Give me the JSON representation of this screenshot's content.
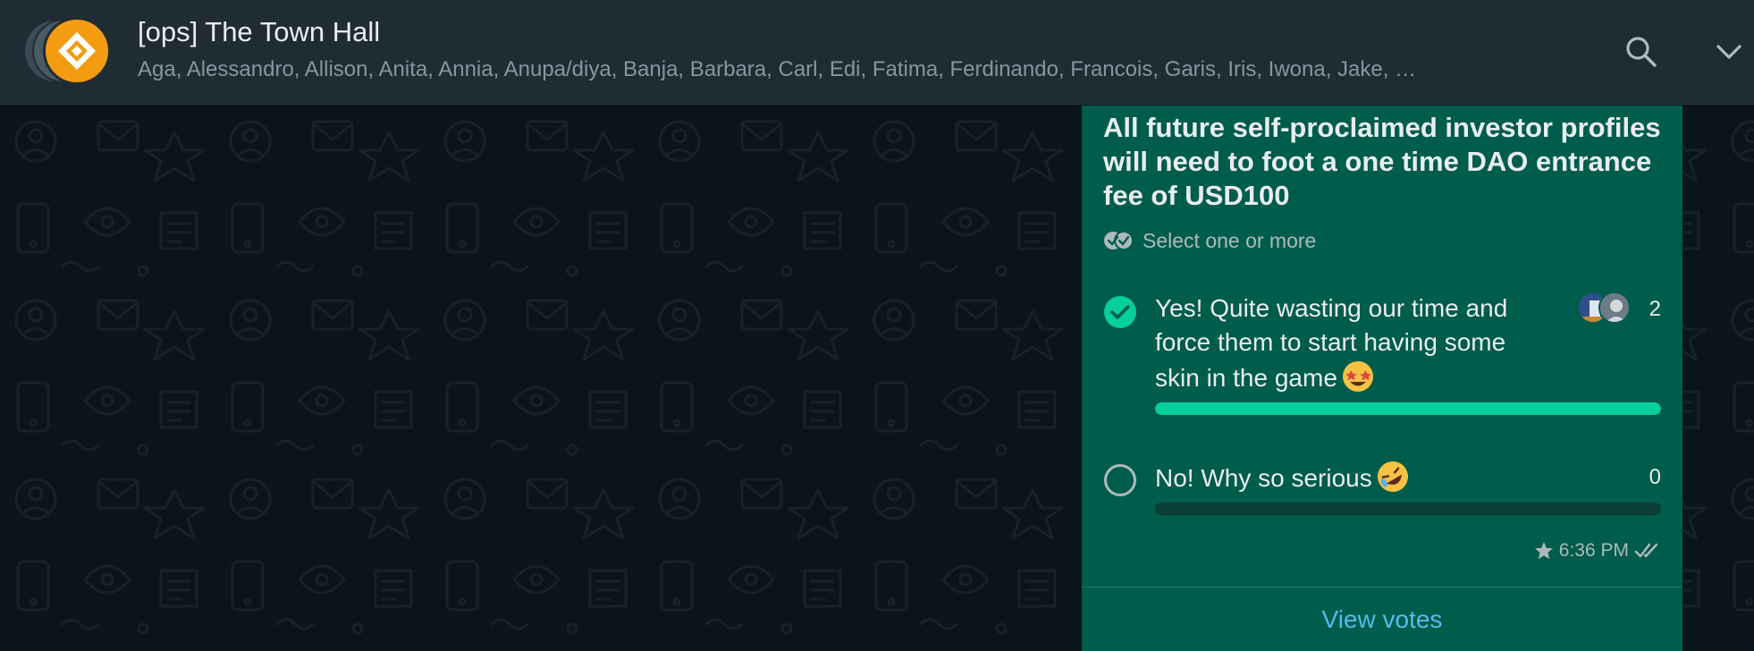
{
  "header": {
    "title": "[ops] The Town Hall",
    "members": "Aga, Alessandro, Allison, Anita, Annia, Anupa/diya, Banja, Barbara, Carl, Edi, Fatima, Ferdinando, Francois, Garis, Iris, Iwona, Jake, …",
    "icons": [
      "group-avatar",
      "search-icon",
      "chevron-down-icon"
    ]
  },
  "poll": {
    "question": "All future self-proclaimed investor profiles will need to foot a one time DAO entrance fee of USD100",
    "hint": "Select one or more",
    "options": [
      {
        "label": "Yes! Quite wasting our time and force them to start having some skin in the game",
        "emoji": "star-struck",
        "votes": "2",
        "selected": true,
        "fraction": 1.0
      },
      {
        "label": "No! Why so serious",
        "emoji": "rolling-on-floor-laughing",
        "votes": "0",
        "selected": false,
        "fraction": 0.0
      }
    ],
    "time": "6:36 PM",
    "starred": true,
    "status": "read",
    "view_votes": "View votes"
  },
  "colors": {
    "header_bg": "#202c33",
    "chat_bg": "#0b141a",
    "bubble_bg": "#005c4b",
    "accent": "#06cf9c",
    "link": "#53bdeb",
    "avatar_orange": "#f39c12"
  }
}
